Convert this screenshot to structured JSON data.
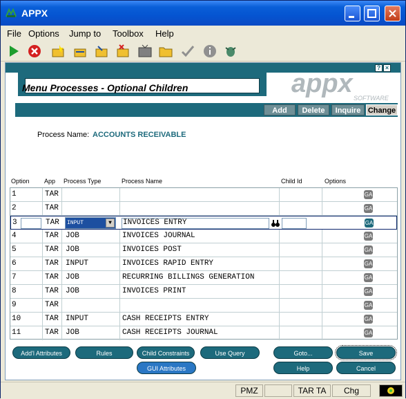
{
  "window": {
    "title": "APPX"
  },
  "menubar": {
    "items": [
      "File",
      "Options",
      "Jump to",
      "Toolbox",
      "Help"
    ]
  },
  "toolbar": {
    "icons": [
      "play-icon",
      "stop-icon",
      "new-icon",
      "edit-icon",
      "export-icon",
      "delete-icon",
      "tv-icon",
      "folder-icon",
      "check-icon",
      "info-icon",
      "bug-icon"
    ]
  },
  "screen": {
    "menu_title": "Menu Processes - Optional Children",
    "logo_text": "appx",
    "logo_subtext": "SOFTWARE",
    "mode_buttons": [
      "Add",
      "Delete",
      "Inquire",
      "Change"
    ],
    "process_name_label": "Process Name:",
    "process_name_value": "ACCOUNTS RECEIVABLE",
    "columns": [
      "Option",
      "App",
      "Process Type",
      "Process Name",
      "Child Id",
      "Options"
    ],
    "rows": [
      {
        "option": "1",
        "app": "TAR",
        "type": "",
        "name": ""
      },
      {
        "option": "2",
        "app": "TAR",
        "type": "",
        "name": ""
      },
      {
        "option": "3",
        "app": "TAR",
        "type": "INPUT",
        "name": "INVOICES ENTRY"
      },
      {
        "option": "4",
        "app": "TAR",
        "type": "JOB",
        "name": "INVOICES JOURNAL"
      },
      {
        "option": "5",
        "app": "TAR",
        "type": "JOB",
        "name": "INVOICES POST"
      },
      {
        "option": "6",
        "app": "TAR",
        "type": "INPUT",
        "name": "INVOICES RAPID ENTRY"
      },
      {
        "option": "7",
        "app": "TAR",
        "type": "JOB",
        "name": "RECURRING BILLINGS GENERATION"
      },
      {
        "option": "8",
        "app": "TAR",
        "type": "JOB",
        "name": "INVOICES PRINT"
      },
      {
        "option": "9",
        "app": "TAR",
        "type": "",
        "name": ""
      },
      {
        "option": "10",
        "app": "TAR",
        "type": "INPUT",
        "name": "CASH RECEIPTS ENTRY"
      },
      {
        "option": "11",
        "app": "TAR",
        "type": "JOB",
        "name": "CASH RECEIPTS JOURNAL"
      }
    ],
    "ga_label": "GA",
    "buttons": {
      "addl_attributes": "Add'l Attributes",
      "rules": "Rules",
      "child_constraints": "Child Constraints",
      "use_query": "Use Query",
      "gui_attributes": "GUI Attributes",
      "goto": "Goto...",
      "help": "Help",
      "save": "Save",
      "cancel": "Cancel"
    }
  },
  "statusbar": {
    "pmz": "PMZ",
    "blank": "",
    "app": "TAR TA",
    "mode": "Chg"
  }
}
